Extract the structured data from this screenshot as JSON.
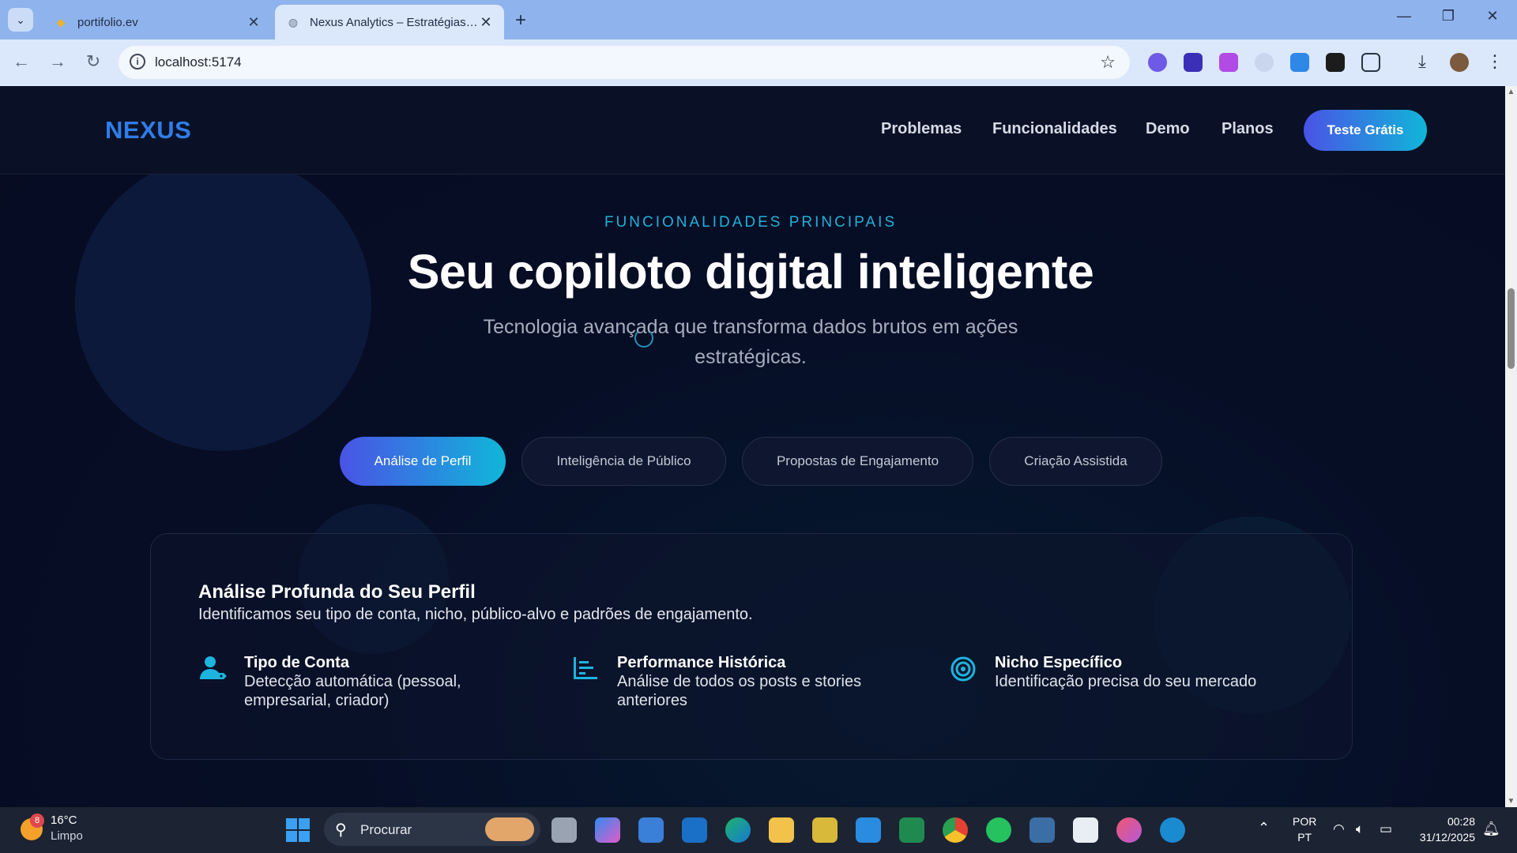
{
  "browser": {
    "tabs": [
      {
        "title": "portifolio.ev",
        "active": false
      },
      {
        "title": "Nexus Analytics – Estratégias Inteligentes",
        "active": true
      }
    ],
    "url": "localhost:5174"
  },
  "nav": {
    "logo": "NEXUS",
    "links": [
      "Problemas",
      "Funcionalidades",
      "Demo",
      "Planos"
    ],
    "cta": "Teste Grátis"
  },
  "hero": {
    "eyebrow": "FUNCIONALIDADES PRINCIPAIS",
    "title": "Seu copiloto digital inteligente",
    "subtitle": "Tecnologia avançada que transforma dados brutos em ações estratégicas."
  },
  "tabs": [
    "Análise de Perfil",
    "Inteligência de Público",
    "Propostas de Engajamento",
    "Criação Assistida"
  ],
  "card": {
    "title": "Análise Profunda do Seu Perfil",
    "description": "Identificamos seu tipo de conta, nicho, público-alvo e padrões de engajamento.",
    "features": [
      {
        "icon": "user-tag-icon",
        "title": "Tipo de Conta",
        "desc": "Detecção automática (pessoal, empresarial, criador)"
      },
      {
        "icon": "bar-chart-icon",
        "title": "Performance Histórica",
        "desc": "Análise de todos os posts e stories anteriores"
      },
      {
        "icon": "target-icon",
        "title": "Nicho Específico",
        "desc": "Identificação precisa do seu mercado"
      }
    ]
  },
  "taskbar": {
    "weather_badge": "8",
    "temperature": "16°C",
    "condition": "Limpo",
    "search_placeholder": "Procurar",
    "lang_top": "POR",
    "lang_bottom": "PT",
    "time": "00:28",
    "date": "31/12/2025"
  },
  "colors": {
    "accent_start": "#4a53e6",
    "accent_end": "#10b6d9",
    "logo": "#2f7de8",
    "eyebrow": "#22b0d8"
  }
}
